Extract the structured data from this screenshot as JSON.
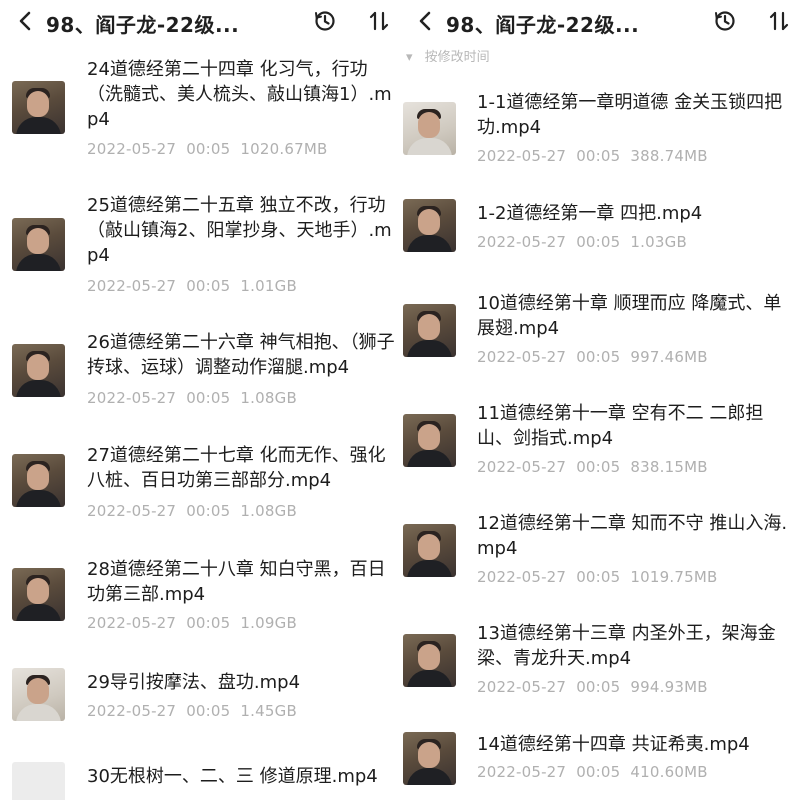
{
  "header": {
    "title": "98、阎子龙-22级..."
  },
  "left": {
    "items": [
      {
        "name": "24道德经第二十四章 化习气，行功（洗髓式、美人梳头、敲山镇海1）.mp4",
        "date": "2022-05-27",
        "time": "00:05",
        "size": "1020.67MB"
      },
      {
        "name": "25道德经第二十五章 独立不改，行功（敲山镇海2、阳掌抄身、天地手）.mp4",
        "date": "2022-05-27",
        "time": "00:05",
        "size": "1.01GB"
      },
      {
        "name": "26道德经第二十六章 神气相抱、（狮子抟球、运球）调整动作溜腿.mp4",
        "date": "2022-05-27",
        "time": "00:05",
        "size": "1.08GB"
      },
      {
        "name": "27道德经第二十七章 化而无作、强化八桩、百日功第三部部分.mp4",
        "date": "2022-05-27",
        "time": "00:05",
        "size": "1.08GB"
      },
      {
        "name": "28道德经第二十八章 知白守黑，百日功第三部.mp4",
        "date": "2022-05-27",
        "time": "00:05",
        "size": "1.09GB"
      },
      {
        "name": "29导引按摩法、盘功.mp4",
        "date": "2022-05-27",
        "time": "00:05",
        "size": "1.45GB"
      },
      {
        "name": "30无根树一、二、三 修道原理.mp4"
      }
    ]
  },
  "right": {
    "group_label": "按修改时间",
    "items": [
      {
        "name": "1-1道德经第一章明道德 金关玉锁四把功.mp4",
        "date": "2022-05-27",
        "time": "00:05",
        "size": "388.74MB"
      },
      {
        "name": "1-2道德经第一章 四把.mp4",
        "date": "2022-05-27",
        "time": "00:05",
        "size": "1.03GB"
      },
      {
        "name": "10道德经第十章 顺理而应 降魔式、单展翅.mp4",
        "date": "2022-05-27",
        "time": "00:05",
        "size": "997.46MB"
      },
      {
        "name": "11道德经第十一章 空有不二 二郎担山、剑指式.mp4",
        "date": "2022-05-27",
        "time": "00:05",
        "size": "838.15MB"
      },
      {
        "name": "12道德经第十二章 知而不守 推山入海.mp4",
        "date": "2022-05-27",
        "time": "00:05",
        "size": "1019.75MB"
      },
      {
        "name": "13道德经第十三章 内圣外王，架海金梁、青龙升天.mp4",
        "date": "2022-05-27",
        "time": "00:05",
        "size": "994.93MB"
      },
      {
        "name": "14道德经第十四章 共证希夷.mp4",
        "date": "2022-05-27",
        "time": "00:05",
        "size": "410.60MB"
      }
    ]
  }
}
